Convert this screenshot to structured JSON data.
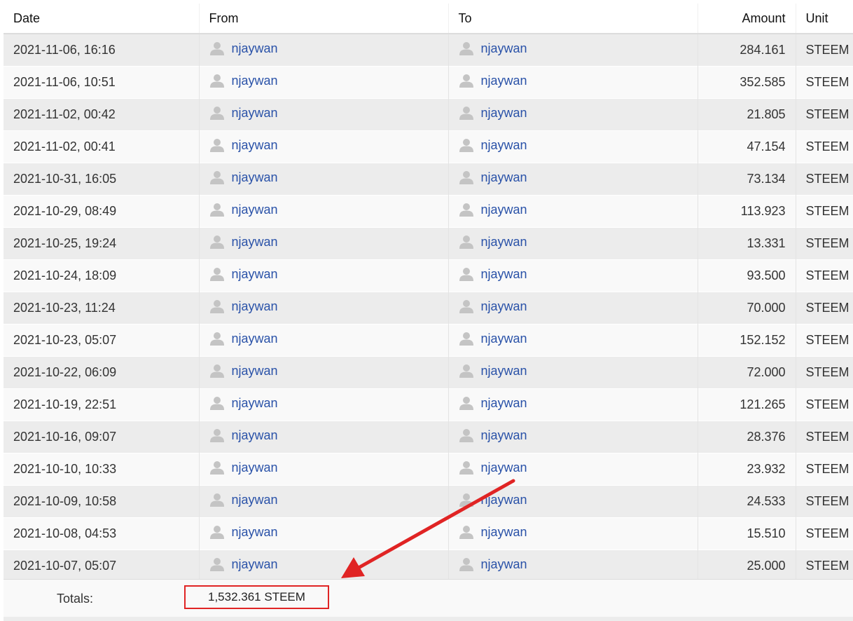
{
  "columns": {
    "date": "Date",
    "from": "From",
    "to": "To",
    "amount": "Amount",
    "unit": "Unit"
  },
  "rows": [
    {
      "date": "2021-11-06, 16:16",
      "from": "njaywan",
      "to": "njaywan",
      "amount": "284.161",
      "unit": "STEEM"
    },
    {
      "date": "2021-11-06, 10:51",
      "from": "njaywan",
      "to": "njaywan",
      "amount": "352.585",
      "unit": "STEEM"
    },
    {
      "date": "2021-11-02, 00:42",
      "from": "njaywan",
      "to": "njaywan",
      "amount": "21.805",
      "unit": "STEEM"
    },
    {
      "date": "2021-11-02, 00:41",
      "from": "njaywan",
      "to": "njaywan",
      "amount": "47.154",
      "unit": "STEEM"
    },
    {
      "date": "2021-10-31, 16:05",
      "from": "njaywan",
      "to": "njaywan",
      "amount": "73.134",
      "unit": "STEEM"
    },
    {
      "date": "2021-10-29, 08:49",
      "from": "njaywan",
      "to": "njaywan",
      "amount": "113.923",
      "unit": "STEEM"
    },
    {
      "date": "2021-10-25, 19:24",
      "from": "njaywan",
      "to": "njaywan",
      "amount": "13.331",
      "unit": "STEEM"
    },
    {
      "date": "2021-10-24, 18:09",
      "from": "njaywan",
      "to": "njaywan",
      "amount": "93.500",
      "unit": "STEEM"
    },
    {
      "date": "2021-10-23, 11:24",
      "from": "njaywan",
      "to": "njaywan",
      "amount": "70.000",
      "unit": "STEEM"
    },
    {
      "date": "2021-10-23, 05:07",
      "from": "njaywan",
      "to": "njaywan",
      "amount": "152.152",
      "unit": "STEEM"
    },
    {
      "date": "2021-10-22, 06:09",
      "from": "njaywan",
      "to": "njaywan",
      "amount": "72.000",
      "unit": "STEEM"
    },
    {
      "date": "2021-10-19, 22:51",
      "from": "njaywan",
      "to": "njaywan",
      "amount": "121.265",
      "unit": "STEEM"
    },
    {
      "date": "2021-10-16, 09:07",
      "from": "njaywan",
      "to": "njaywan",
      "amount": "28.376",
      "unit": "STEEM"
    },
    {
      "date": "2021-10-10, 10:33",
      "from": "njaywan",
      "to": "njaywan",
      "amount": "23.932",
      "unit": "STEEM"
    },
    {
      "date": "2021-10-09, 10:58",
      "from": "njaywan",
      "to": "njaywan",
      "amount": "24.533",
      "unit": "STEEM"
    },
    {
      "date": "2021-10-08, 04:53",
      "from": "njaywan",
      "to": "njaywan",
      "amount": "15.510",
      "unit": "STEEM"
    },
    {
      "date": "2021-10-07, 05:07",
      "from": "njaywan",
      "to": "njaywan",
      "amount": "25.000",
      "unit": "STEEM"
    }
  ],
  "totals": {
    "label": "Totals:",
    "value": "1,532.361 STEEM"
  },
  "icons": {
    "user": "user-avatar-icon",
    "arrow": "red-arrow-annotation"
  },
  "colors": {
    "link": "#2a52a8",
    "annotation": "#e02424",
    "row_odd": "#ececec",
    "row_even": "#f9f9f9"
  }
}
